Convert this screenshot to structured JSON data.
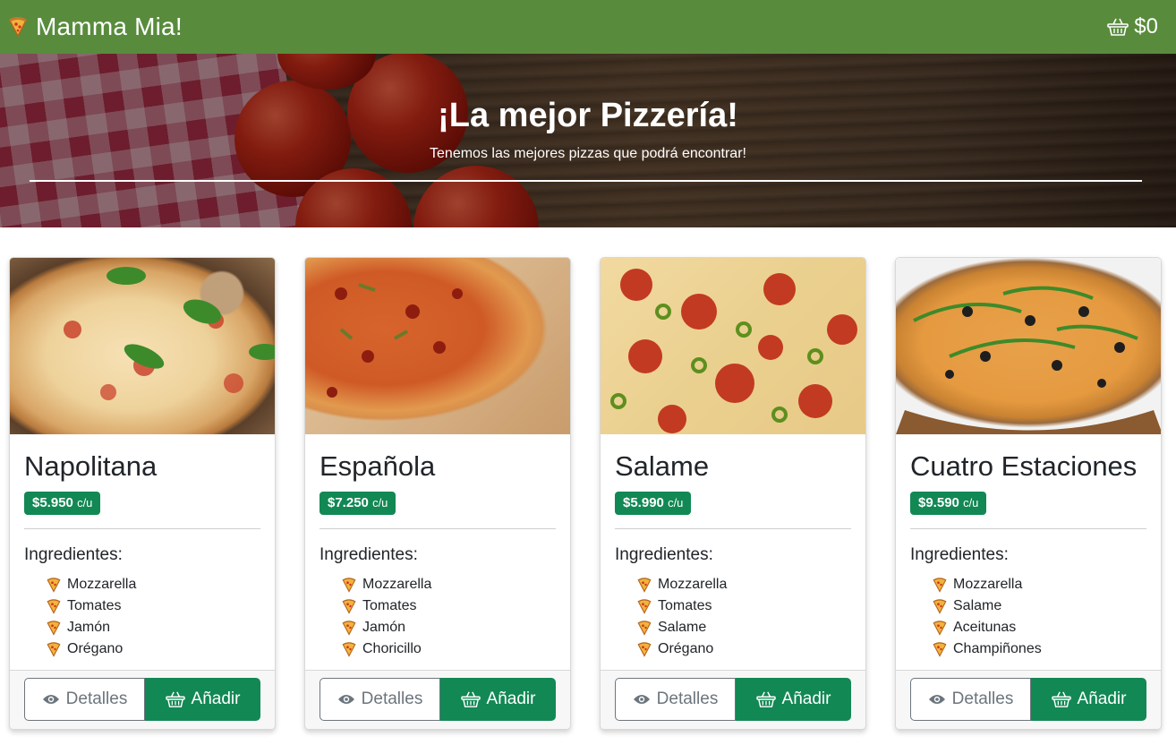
{
  "navbar": {
    "brand": "Mamma Mia!",
    "brand_icon": "pizza-slice-icon",
    "cart_total": "$0",
    "cart_icon": "basket-icon"
  },
  "hero": {
    "title": "¡La mejor Pizzería!",
    "subtitle": "Tenemos las mejores pizzas que podrá encontrar!"
  },
  "colors": {
    "navbar": "#588c3c",
    "accent": "#128854",
    "secondary": "#6c757d"
  },
  "labels": {
    "ingredients": "Ingredientes:",
    "details": "Detalles",
    "add": "Añadir",
    "unit": "c/u"
  },
  "pizzas": [
    {
      "name": "Napolitana",
      "price": "$5.950",
      "ingredients": [
        "Mozzarella",
        "Tomates",
        "Jamón",
        "Orégano"
      ]
    },
    {
      "name": "Española",
      "price": "$7.250",
      "ingredients": [
        "Mozzarella",
        "Tomates",
        "Jamón",
        "Choricillo"
      ]
    },
    {
      "name": "Salame",
      "price": "$5.990",
      "ingredients": [
        "Mozzarella",
        "Tomates",
        "Salame",
        "Orégano"
      ]
    },
    {
      "name": "Cuatro Estaciones",
      "price": "$9.590",
      "ingredients": [
        "Mozzarella",
        "Salame",
        "Aceitunas",
        "Champiñones"
      ]
    }
  ]
}
